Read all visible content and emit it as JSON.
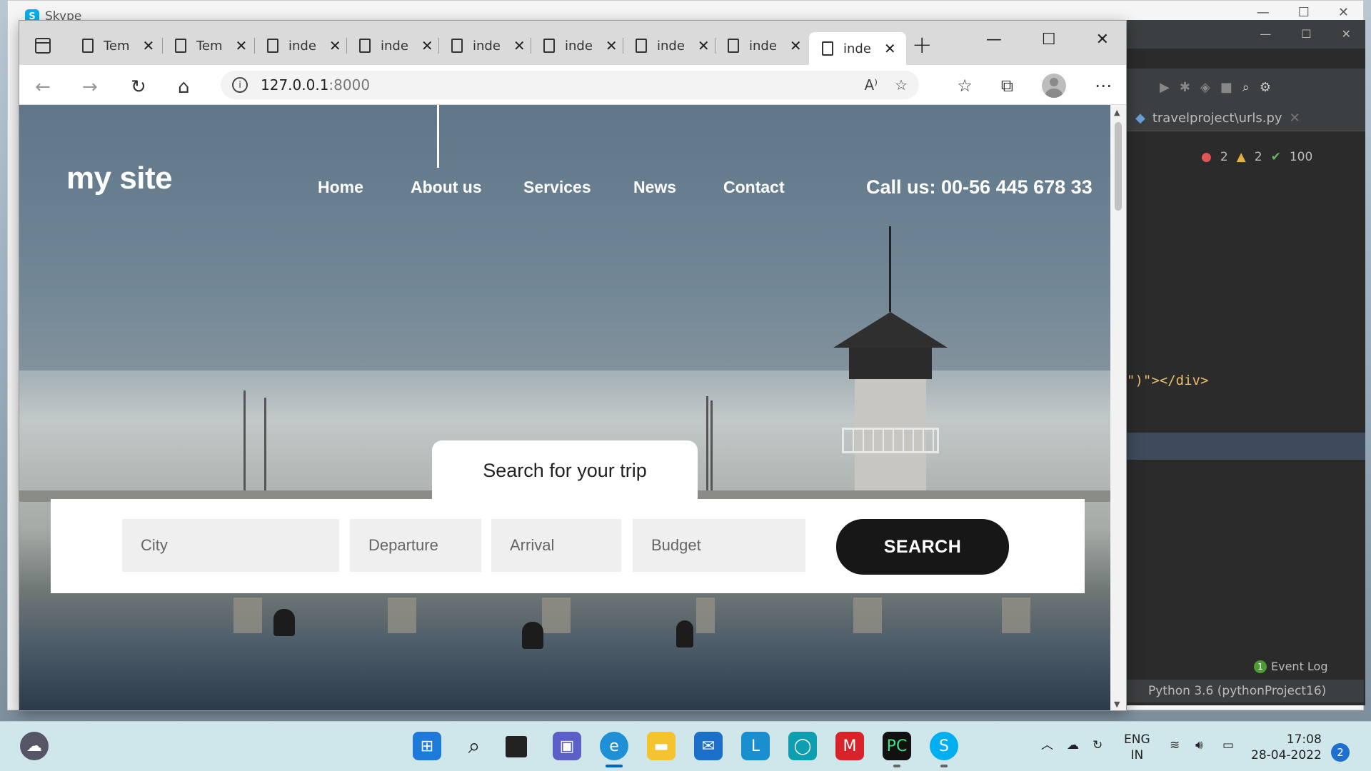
{
  "skype": {
    "title": "Skype"
  },
  "browser": {
    "tabs": [
      {
        "label": "Tem"
      },
      {
        "label": "Tem"
      },
      {
        "label": "inde"
      },
      {
        "label": "inde"
      },
      {
        "label": "inde"
      },
      {
        "label": "inde"
      },
      {
        "label": "inde"
      },
      {
        "label": "inde"
      },
      {
        "label": "inde",
        "active": true
      }
    ],
    "url": {
      "host": "127.0.0.1",
      "port": ":8000"
    }
  },
  "site": {
    "logo": "my site",
    "nav": [
      "Home",
      "About us",
      "Services",
      "News",
      "Contact"
    ],
    "active_nav": "About us",
    "phone": "Call us: 00-56 445 678 33",
    "search": {
      "tab_title": "Search for your trip",
      "fields": {
        "city": "City",
        "departure": "Departure",
        "arrival": "Arrival",
        "budget": "Budget"
      },
      "button": "SEARCH"
    }
  },
  "pycharm": {
    "file_tab": "travelproject\\urls.py",
    "inspections": {
      "errors": "2",
      "warnings": "2",
      "ok": "100"
    },
    "code_line": "\")\"></div>",
    "event_log": "Event Log",
    "event_log_count": "1",
    "interpreter": "Python 3.6 (pythonProject16)"
  },
  "taskbar": {
    "language": "ENG",
    "region": "IN",
    "time": "17:08",
    "date": "28-04-2022",
    "notifications": "2"
  }
}
